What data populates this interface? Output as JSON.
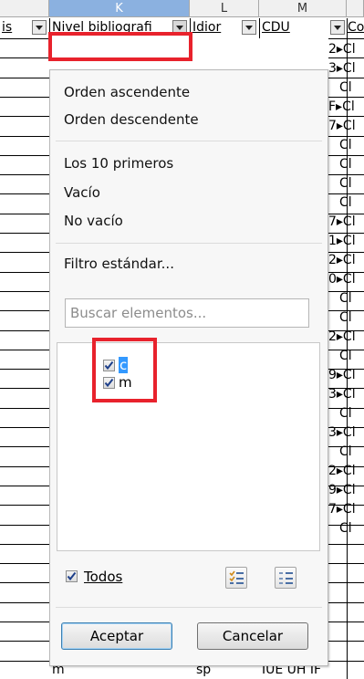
{
  "columns": {
    "k": "K",
    "l": "L",
    "m": "M"
  },
  "header_cells": {
    "left_fragment": "is",
    "nivel": "Nivel bibliografi",
    "idioma": "Idior",
    "cdu": "CDU",
    "right_fragment": "Co"
  },
  "right_cells": [
    "2▸Cl",
    "3▸Cl",
    "Cl",
    "F▸Cl",
    "7▸Cl",
    "Cl",
    "Cl",
    "Cl",
    "Cl",
    "7▸Cl",
    "1▸Cl",
    "2▸Cl",
    "0▸Cl",
    "Cl",
    "Cl",
    "2▸Cl",
    "Cl",
    "9▸Cl",
    "3▸Cl",
    "Cl",
    "3▸Cl",
    "Cl",
    "2▸Cl",
    "9▸Cl",
    "7▸Cl",
    "Cl"
  ],
  "bottom_row": {
    "nivel": "m",
    "idioma": "sp",
    "cdu": "IUE UH IF"
  },
  "menu": {
    "sort_asc": "Orden ascendente",
    "sort_desc": "Orden descendente",
    "top10": "Los 10 primeros",
    "empty": "Vacío",
    "not_empty": "No vacío",
    "standard_filter": "Filtro estándar..."
  },
  "search": {
    "placeholder": "Buscar elementos..."
  },
  "items": [
    {
      "label": "c",
      "checked": true
    },
    {
      "label": "m",
      "checked": true
    }
  ],
  "all": {
    "label": "Todos",
    "checked": true
  },
  "buttons": {
    "ok": "Aceptar",
    "cancel": "Cancelar"
  },
  "colors": {
    "highlight": "#e8222c",
    "selection": "#3399ff",
    "column_selected": "#8bb1e0"
  }
}
